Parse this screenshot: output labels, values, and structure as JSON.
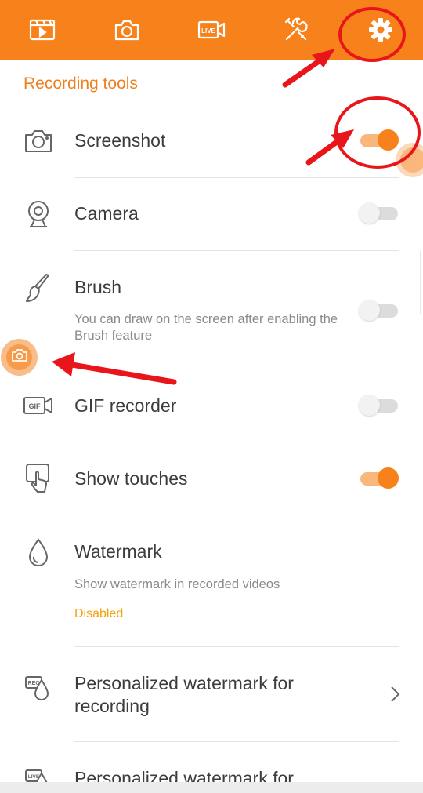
{
  "tabs": [
    {
      "icon": "video-list-icon"
    },
    {
      "icon": "camera-icon"
    },
    {
      "icon": "live-icon",
      "badge": "LIVE"
    },
    {
      "icon": "tools-icon"
    },
    {
      "icon": "gear-icon"
    }
  ],
  "section_title": "Recording tools",
  "rows": [
    {
      "title": "Screenshot",
      "icon": "camera-icon",
      "toggle": true
    },
    {
      "title": "Camera",
      "icon": "webcam-icon",
      "toggle": false
    },
    {
      "title": "Brush",
      "icon": "brush-icon",
      "desc": "You can draw on the screen after enabling the Brush feature",
      "toggle": false
    },
    {
      "title": "GIF recorder",
      "icon": "gif-icon",
      "icon_text": "GIF",
      "toggle": false
    },
    {
      "title": "Show touches",
      "icon": "touch-icon",
      "toggle": true
    },
    {
      "title": "Watermark",
      "icon": "drop-icon",
      "desc": "Show watermark in recorded videos",
      "status": "Disabled"
    },
    {
      "title": "Personalized watermark for recording",
      "icon": "rec-watermark-icon",
      "icon_text": "REC"
    },
    {
      "title": "Personalized watermark for",
      "icon": "live-watermark-icon",
      "icon_text": "LIVE"
    }
  ],
  "colors": {
    "accent": "#f7821b",
    "annotation": "#e8161b",
    "status": "#f5a10d"
  }
}
